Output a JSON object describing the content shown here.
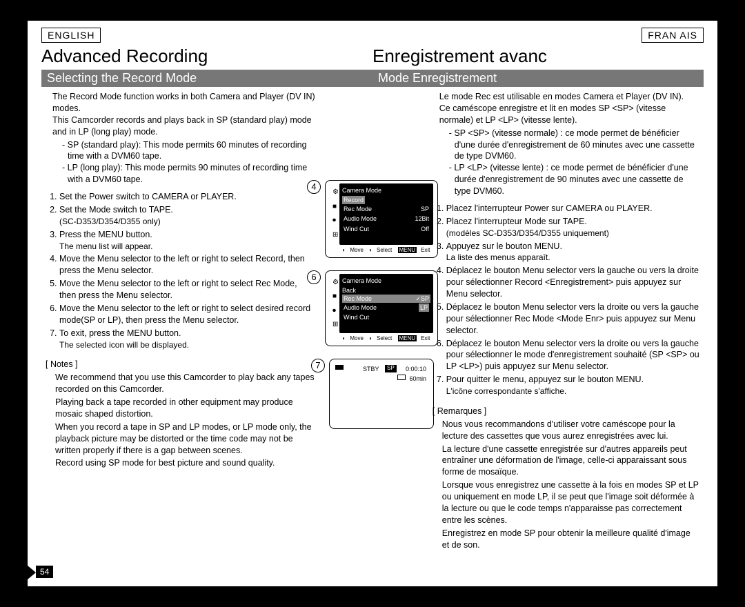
{
  "lang": {
    "left": "ENGLISH",
    "right": "FRAN AIS"
  },
  "title": {
    "left": "Advanced Recording",
    "right": "Enregistrement avanc"
  },
  "subtitle": {
    "left": "Selecting the Record Mode",
    "right": "Mode Enregistrement"
  },
  "en": {
    "intro1": "The Record Mode function works in both Camera and Player (DV IN) modes.",
    "intro2": "This Camcorder records and plays back in SP (standard play) mode and in LP (long play) mode.",
    "sp": "SP (standard play): This mode permits 60 minutes of recording time with a DVM60 tape.",
    "lp": "LP (long play): This mode permits 90 minutes of recording time with a DVM60 tape.",
    "s1": "Set the Power switch to CAMERA or PLAYER.",
    "s2": "Set the Mode switch to TAPE.",
    "s2n": "(SC-D353/D354/D355 only)",
    "s3": "Press the MENU button.",
    "s3n": "The menu list will appear.",
    "s4": "Move the Menu selector to the left or right to select Record, then press the Menu selector.",
    "s5": "Move the Menu selector to the left or right to select Rec Mode, then press the Menu selector.",
    "s6": "Move the Menu selector to the left or right to select desired record mode(SP or LP), then press the Menu selector.",
    "s7": "To exit, press the MENU button.",
    "s7n": "The selected icon will be displayed.",
    "notes_head": "[ Notes ]",
    "n1": "We recommend that you use this Camcorder to play back any tapes recorded on this Camcorder.",
    "n2": "Playing back a tape recorded in other equipment may produce mosaic shaped distortion.",
    "n3": "When you record a tape in SP and LP modes, or LP mode only, the playback picture may be distorted or the time code may not be written properly if there is a gap between scenes.",
    "n4": "Record using SP mode for best picture and sound quality."
  },
  "fr": {
    "intro1": "Le mode Rec est utilisable en modes Camera et Player (DV IN).",
    "intro2": "Ce caméscope enregistre et lit en modes SP <SP> (vitesse normale) et LP <LP> (vitesse lente).",
    "sp": "SP <SP> (vitesse normale) : ce mode permet de bénéficier d'une durée d'enregistrement de 60 minutes avec une cassette de type DVM60.",
    "lp": "LP <LP> (vitesse lente) : ce mode permet de bénéficier d'une durée d'enregistrement de 90 minutes avec une cassette de type DVM60.",
    "s1": "Placez l'interrupteur Power sur CAMERA ou PLAYER.",
    "s2": "Placez l'interrupteur Mode sur TAPE.",
    "s2n": "(modèles SC-D353/D354/D355 uniquement)",
    "s3": "Appuyez sur le bouton MENU.",
    "s3n": "La liste des menus apparaît.",
    "s4": "Déplacez le bouton Menu selector vers la gauche ou vers la droite pour sélectionner Record <Enregistrement> puis appuyez sur Menu selector.",
    "s5": "Déplacez le bouton Menu selector vers la droite ou vers la gauche pour sélectionner Rec Mode <Mode Enr> puis appuyez sur Menu selector.",
    "s6": "Déplacez le bouton Menu selector vers la droite ou vers la gauche pour sélectionner le mode d'enregistrement souhaité (SP <SP> ou LP <LP>) puis appuyez sur Menu selector.",
    "s7": "Pour quitter le menu, appuyez sur le bouton MENU.",
    "s7n": "L'icône correspondante s'affiche.",
    "notes_head": "[ Remarques ]",
    "n1": "Nous vous recommandons d'utiliser votre caméscope pour la lecture des cassettes que vous aurez enregistrées avec lui.",
    "n2": "La lecture d'une cassette enregistrée sur d'autres appareils peut entraîner une déformation de l'image, celle-ci apparaissant sous forme de mosaïque.",
    "n3": "Lorsque vous enregistrez une cassette à la fois en modes SP et LP ou uniquement en mode LP, il se peut que l'image soit déformée à la lecture ou que le code temps n'apparaisse pas correctement entre les scènes.",
    "n4": "Enregistrez en mode SP pour obtenir la meilleure qualité d'image et de son."
  },
  "callouts": {
    "c4": "4",
    "c6": "6",
    "c7": "7"
  },
  "lcd4": {
    "title": "Camera Mode",
    "hl": "Record",
    "r1a": "Rec Mode",
    "r1b": "SP",
    "r2a": "Audio Mode",
    "r2b": "12Bit",
    "r3a": "Wind Cut",
    "r3b": "Off",
    "ft_move": "Move",
    "ft_select": "Select",
    "ft_exit": "Exit",
    "ft_menu": "MENU"
  },
  "lcd6": {
    "title": "Camera Mode",
    "back": "Back",
    "hl_a": "Rec Mode",
    "hl_b": "✓SP",
    "r2a": "Audio Mode",
    "r2b": "LP",
    "r3a": "Wind Cut",
    "ft_move": "Move",
    "ft_select": "Select",
    "ft_exit": "Exit",
    "ft_menu": "MENU"
  },
  "lcd7": {
    "status": "STBY",
    "mode": "SP",
    "tc": "0:00:10",
    "remain": "60min"
  },
  "page_number": "54"
}
